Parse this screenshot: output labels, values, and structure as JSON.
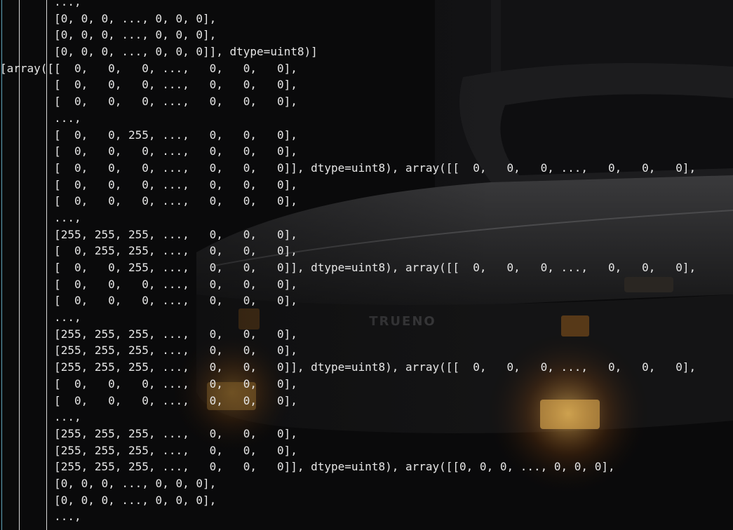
{
  "console": {
    "lines": [
      "        ...,",
      "        [0, 0, 0, ..., 0, 0, 0],",
      "        [0, 0, 0, ..., 0, 0, 0],",
      "        [0, 0, 0, ..., 0, 0, 0]], dtype=uint8)]",
      "[array([[  0,   0,   0, ...,   0,   0,   0],",
      "        [  0,   0,   0, ...,   0,   0,   0],",
      "        [  0,   0,   0, ...,   0,   0,   0],",
      "        ...,",
      "        [  0,   0, 255, ...,   0,   0,   0],",
      "        [  0,   0,   0, ...,   0,   0,   0],",
      "        [  0,   0,   0, ...,   0,   0,   0]], dtype=uint8), array([[  0,   0,   0, ...,   0,   0,   0],",
      "        [  0,   0,   0, ...,   0,   0,   0],",
      "        [  0,   0,   0, ...,   0,   0,   0],",
      "        ...,",
      "        [255, 255, 255, ...,   0,   0,   0],",
      "        [  0, 255, 255, ...,   0,   0,   0],",
      "        [  0,   0, 255, ...,   0,   0,   0]], dtype=uint8), array([[  0,   0,   0, ...,   0,   0,   0],",
      "        [  0,   0,   0, ...,   0,   0,   0],",
      "        [  0,   0,   0, ...,   0,   0,   0],",
      "        ...,",
      "        [255, 255, 255, ...,   0,   0,   0],",
      "        [255, 255, 255, ...,   0,   0,   0],",
      "        [255, 255, 255, ...,   0,   0,   0]], dtype=uint8), array([[  0,   0,   0, ...,   0,   0,   0],",
      "        [  0,   0,   0, ...,   0,   0,   0],",
      "        [  0,   0,   0, ...,   0,   0,   0],",
      "        ...,",
      "        [255, 255, 255, ...,   0,   0,   0],",
      "        [255, 255, 255, ...,   0,   0,   0],",
      "        [255, 255, 255, ...,   0,   0,   0]], dtype=uint8), array([[0, 0, 0, ..., 0, 0, 0],",
      "        [0, 0, 0, ..., 0, 0, 0],",
      "        [0, 0, 0, ..., 0, 0, 0],",
      "        ...,"
    ]
  },
  "wallpaper": {
    "plate_text": "TRUENO"
  },
  "colors": {
    "background": "#0a0a0b",
    "text": "#e6e6e6",
    "guide_primary": "#5fa3b8",
    "guide_secondary": "#d8d8d8",
    "headlight_glow": "#d98a1e"
  }
}
